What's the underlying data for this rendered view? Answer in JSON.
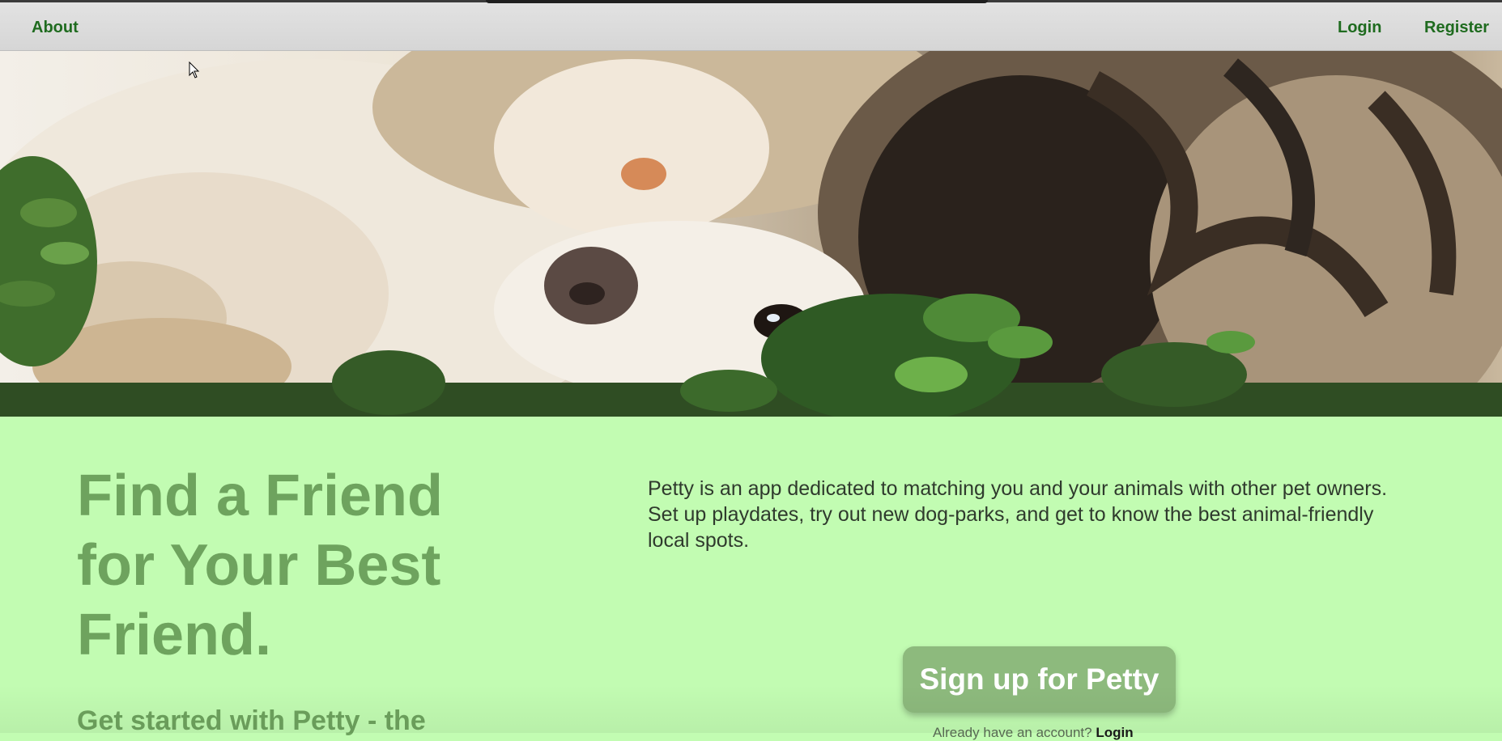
{
  "nav": {
    "about": "About",
    "login": "Login",
    "register": "Register"
  },
  "hero": {
    "image_alt": "Cat and dog lying together in the grass"
  },
  "content": {
    "headline": "Find a Friend for Your Best Friend.",
    "subheadline": "Get started with Petty - the",
    "description": "Petty is an app dedicated to matching you and your animals with other pet owners. Set up playdates, try out new dog-parks, and get to know the best animal-friendly local spots.",
    "signup_button": "Sign up for Petty",
    "login_prompt": "Already have an account?",
    "login_link": "Login"
  },
  "colors": {
    "nav_link": "#1f6b1f",
    "page_background": "#c2fcb2",
    "headline": "#6ea35e",
    "button": "#8dba7d"
  }
}
